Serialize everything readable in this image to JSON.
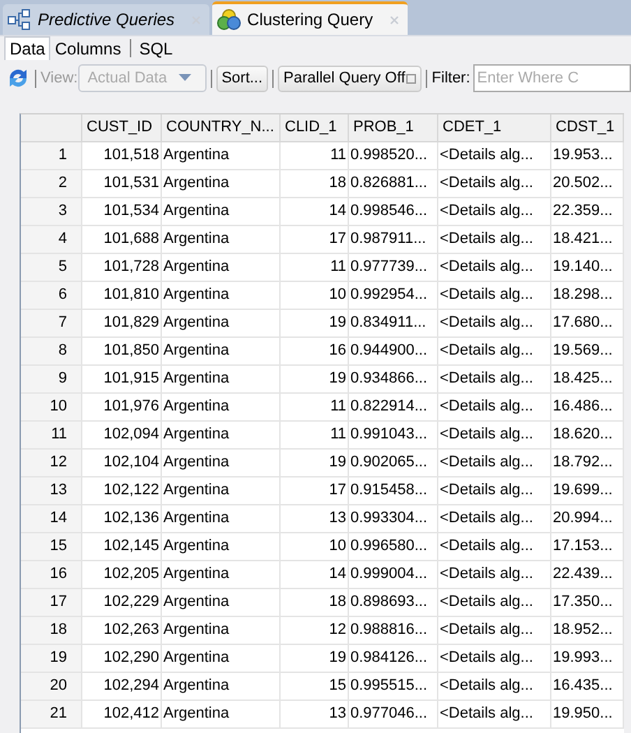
{
  "tabs": [
    {
      "label": "Predictive Queries",
      "selected": false
    },
    {
      "label": "Clustering Query",
      "selected": true
    }
  ],
  "subtabs": [
    {
      "label": "Data",
      "selected": true
    },
    {
      "label": "Columns",
      "selected": false
    },
    {
      "label": "SQL",
      "selected": false
    }
  ],
  "toolbar": {
    "view_label": "View:",
    "view_value": "Actual Data",
    "view_disabled": true,
    "sort": "Sort...",
    "parallel": "Parallel Query Off",
    "filter_label": "Filter:",
    "filter_placeholder": "Enter Where C"
  },
  "table": {
    "columns": [
      "",
      "CUST_ID",
      "COUNTRY_N...",
      "CLID_1",
      "PROB_1",
      "CDET_1",
      "CDST_1"
    ],
    "rows": [
      [
        "1",
        "101,518",
        "Argentina",
        "11",
        "0.998520...",
        "<Details alg...",
        "19.953..."
      ],
      [
        "2",
        "101,531",
        "Argentina",
        "18",
        "0.826881...",
        "<Details alg...",
        "20.502..."
      ],
      [
        "3",
        "101,534",
        "Argentina",
        "14",
        "0.998546...",
        "<Details alg...",
        "22.359..."
      ],
      [
        "4",
        "101,688",
        "Argentina",
        "17",
        "0.987911...",
        "<Details alg...",
        "18.421..."
      ],
      [
        "5",
        "101,728",
        "Argentina",
        "11",
        "0.977739...",
        "<Details alg...",
        "19.140..."
      ],
      [
        "6",
        "101,810",
        "Argentina",
        "10",
        "0.992954...",
        "<Details alg...",
        "18.298..."
      ],
      [
        "7",
        "101,829",
        "Argentina",
        "19",
        "0.834911...",
        "<Details alg...",
        "17.680..."
      ],
      [
        "8",
        "101,850",
        "Argentina",
        "16",
        "0.944900...",
        "<Details alg...",
        "19.569..."
      ],
      [
        "9",
        "101,915",
        "Argentina",
        "19",
        "0.934866...",
        "<Details alg...",
        "18.425..."
      ],
      [
        "10",
        "101,976",
        "Argentina",
        "11",
        "0.822914...",
        "<Details alg...",
        "16.486..."
      ],
      [
        "11",
        "102,094",
        "Argentina",
        "11",
        "0.991043...",
        "<Details alg...",
        "18.620..."
      ],
      [
        "12",
        "102,104",
        "Argentina",
        "19",
        "0.902065...",
        "<Details alg...",
        "18.792..."
      ],
      [
        "13",
        "102,122",
        "Argentina",
        "17",
        "0.915458...",
        "<Details alg...",
        "19.699..."
      ],
      [
        "14",
        "102,136",
        "Argentina",
        "13",
        "0.993304...",
        "<Details alg...",
        "20.994..."
      ],
      [
        "15",
        "102,145",
        "Argentina",
        "10",
        "0.996580...",
        "<Details alg...",
        "17.153..."
      ],
      [
        "16",
        "102,205",
        "Argentina",
        "14",
        "0.999004...",
        "<Details alg...",
        "22.439..."
      ],
      [
        "17",
        "102,229",
        "Argentina",
        "18",
        "0.898693...",
        "<Details alg...",
        "17.350..."
      ],
      [
        "18",
        "102,263",
        "Argentina",
        "12",
        "0.988816...",
        "<Details alg...",
        "18.952..."
      ],
      [
        "19",
        "102,290",
        "Argentina",
        "19",
        "0.984126...",
        "<Details alg...",
        "19.993..."
      ],
      [
        "20",
        "102,294",
        "Argentina",
        "15",
        "0.995515...",
        "<Details alg...",
        "16.435..."
      ],
      [
        "21",
        "102,412",
        "Argentina",
        "13",
        "0.977046...",
        "<Details alg...",
        "19.950..."
      ]
    ]
  }
}
